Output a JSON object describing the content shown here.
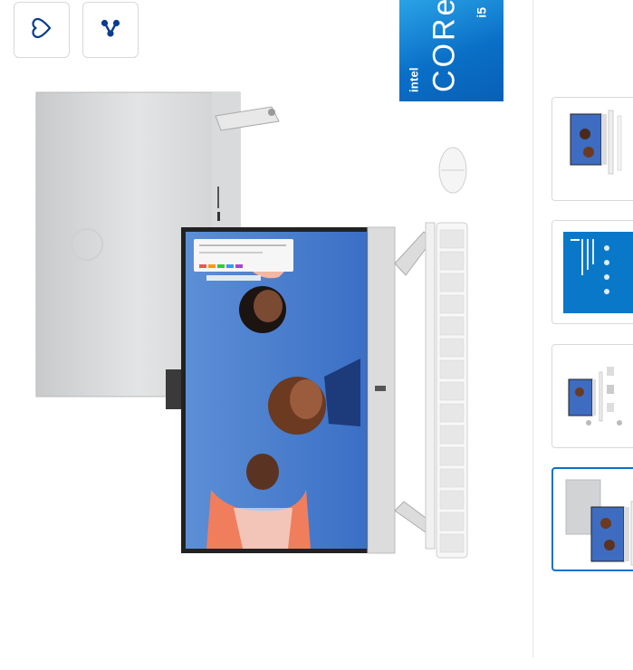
{
  "actions": {
    "favorite_icon": "heart-outline-icon",
    "share_icon": "share-network-icon"
  },
  "intel_badge": {
    "brand": "intel",
    "line": "CORe",
    "tier": "i5",
    "colors": {
      "top": "#2aa3e6",
      "bottom": "#0860b5"
    }
  },
  "thumbnails": [
    {
      "id": "thumb-1",
      "selected": false
    },
    {
      "id": "thumb-2",
      "selected": false
    },
    {
      "id": "thumb-3",
      "selected": false
    },
    {
      "id": "thumb-4",
      "selected": true
    }
  ],
  "colors": {
    "accent": "#0672cb",
    "border": "#d6d9dc",
    "icon": "#0a3d91"
  }
}
